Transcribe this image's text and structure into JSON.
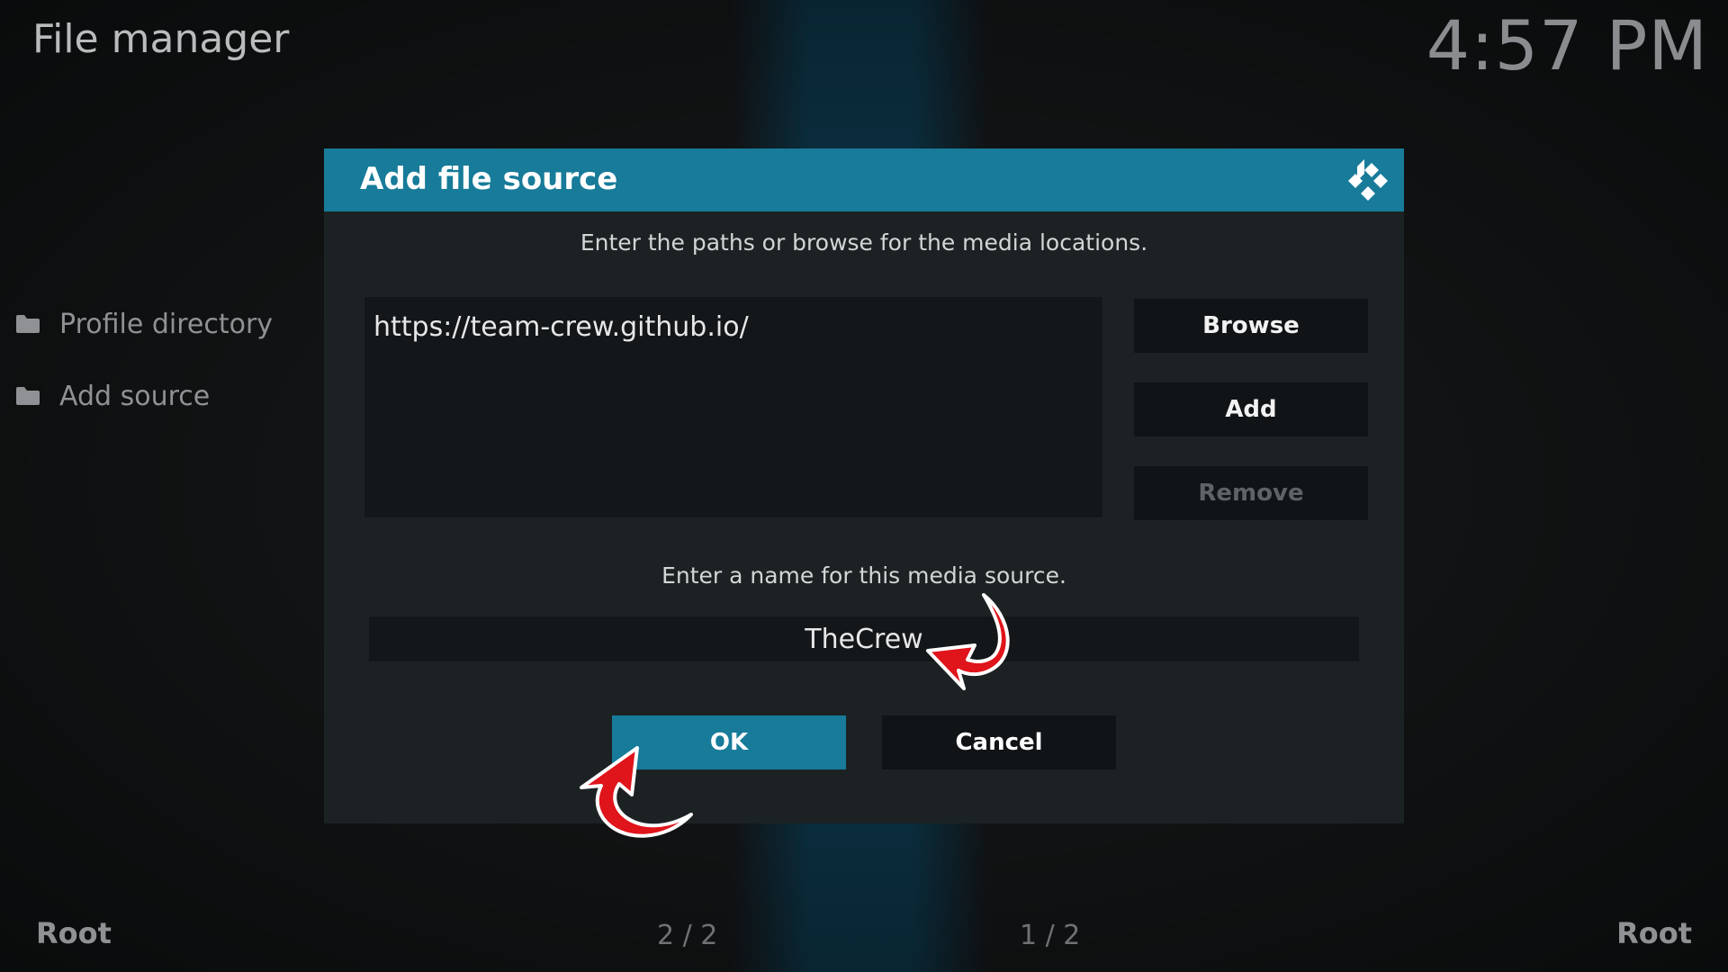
{
  "header": {
    "title": "File manager",
    "clock": "4:57 PM"
  },
  "sidebar": {
    "items": [
      {
        "label": "Profile directory",
        "icon": "folder-icon"
      },
      {
        "label": "Add source",
        "icon": "folder-icon"
      }
    ]
  },
  "footer": {
    "left_label": "Root",
    "left_page": "2 / 2",
    "right_page": "1 / 2",
    "right_label": "Root"
  },
  "dialog": {
    "title": "Add file source",
    "logo_icon": "kodi-logo-icon",
    "paths_instruction": "Enter the paths or browse for the media locations.",
    "paths": [
      "https://team-crew.github.io/"
    ],
    "browse_label": "Browse",
    "add_label": "Add",
    "remove_label": "Remove",
    "name_instruction": "Enter a name for this media source.",
    "name_value": "TheCrew",
    "ok_label": "OK",
    "cancel_label": "Cancel"
  },
  "colors": {
    "accent": "#177b99",
    "dialog_bg": "#1c2224",
    "annotation_arrow": "#e0141b"
  }
}
